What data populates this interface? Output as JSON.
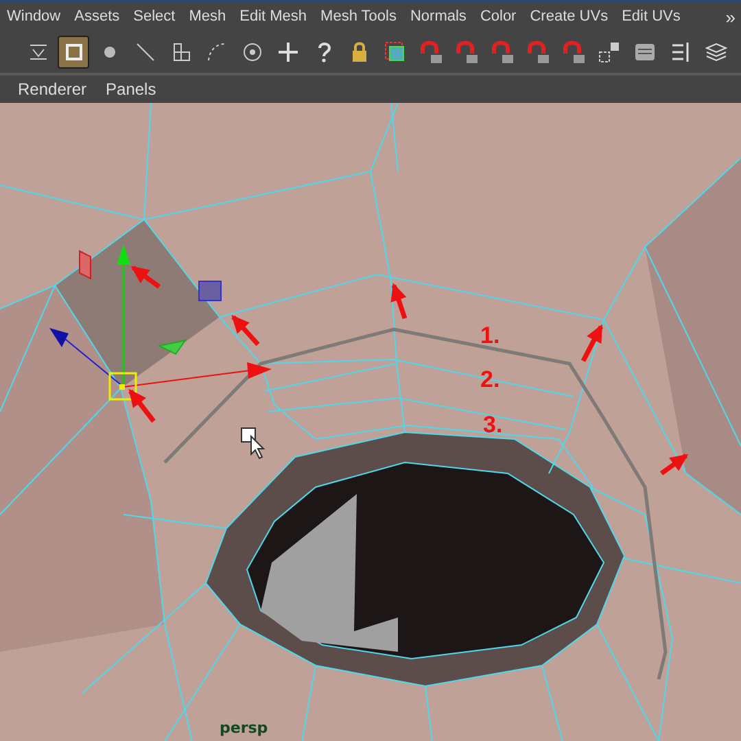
{
  "menu_bar": {
    "items": [
      "Window",
      "Assets",
      "Select",
      "Mesh",
      "Edit Mesh",
      "Mesh Tools",
      "Normals",
      "Color",
      "Create UVs",
      "Edit UVs"
    ],
    "overflow": "»"
  },
  "toolbar": {
    "tools": [
      {
        "kind": "collapse",
        "selected": false
      },
      {
        "kind": "object",
        "selected": true
      },
      {
        "kind": "vertex",
        "selected": false
      },
      {
        "kind": "edge",
        "selected": false
      },
      {
        "kind": "face",
        "selected": false
      },
      {
        "kind": "curve",
        "selected": false
      },
      {
        "kind": "target",
        "selected": false
      },
      {
        "kind": "plus",
        "selected": false
      },
      {
        "kind": "help",
        "selected": false
      },
      {
        "kind": "lock",
        "selected": false
      },
      {
        "kind": "select",
        "selected": false
      },
      {
        "kind": "magnet-grid",
        "selected": false
      },
      {
        "kind": "magnet-curve",
        "selected": false
      },
      {
        "kind": "magnet-point",
        "selected": false
      },
      {
        "kind": "magnet-sphere",
        "selected": false
      },
      {
        "kind": "magnet-plane",
        "selected": false
      },
      {
        "kind": "live",
        "selected": false
      },
      {
        "kind": "window",
        "selected": false
      },
      {
        "kind": "list",
        "selected": false
      },
      {
        "kind": "layers",
        "selected": false
      }
    ]
  },
  "panel_menu": [
    "Renderer",
    "Panels"
  ],
  "viewport": {
    "annotations": [
      "1.",
      "2.",
      "3."
    ],
    "camera": "persp"
  }
}
